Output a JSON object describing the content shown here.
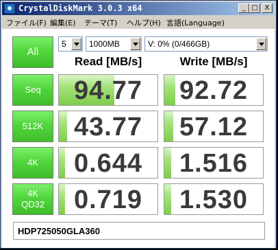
{
  "window": {
    "title": "CrystalDiskMark 3.0.3 x64",
    "controls": {
      "minimize": "_",
      "maximize": "□",
      "close": "X"
    }
  },
  "menu": [
    "ファイル(F)",
    "編集(E)",
    "テーマ(T)",
    "ヘルプ(H)",
    "言語(Language)"
  ],
  "toolbar": {
    "all_button": "All",
    "runs": "5",
    "size": "1000MB",
    "drive": "V: 0% (0/466GB)"
  },
  "headers": {
    "read": "Read [MB/s]",
    "write": "Write [MB/s]"
  },
  "tests": [
    {
      "label": [
        "Seq"
      ],
      "read": "94.77",
      "write": "92.72",
      "read_fill": 0.56,
      "write_fill": 0.11
    },
    {
      "label": [
        "512K"
      ],
      "read": "43.77",
      "write": "57.12",
      "read_fill": 0.08,
      "write_fill": 0.09
    },
    {
      "label": [
        "4K"
      ],
      "read": "0.644",
      "write": "1.516",
      "read_fill": 0.06,
      "write_fill": 0.07
    },
    {
      "label": [
        "4K",
        "QD32"
      ],
      "read": "0.719",
      "write": "1.530",
      "read_fill": 0.06,
      "write_fill": 0.07
    }
  ],
  "comment": "HDP725050GLA360",
  "colors": {
    "button_green": "#52d63c",
    "bar_green": "#7fcd4c",
    "title_blue": "#0a246a"
  }
}
